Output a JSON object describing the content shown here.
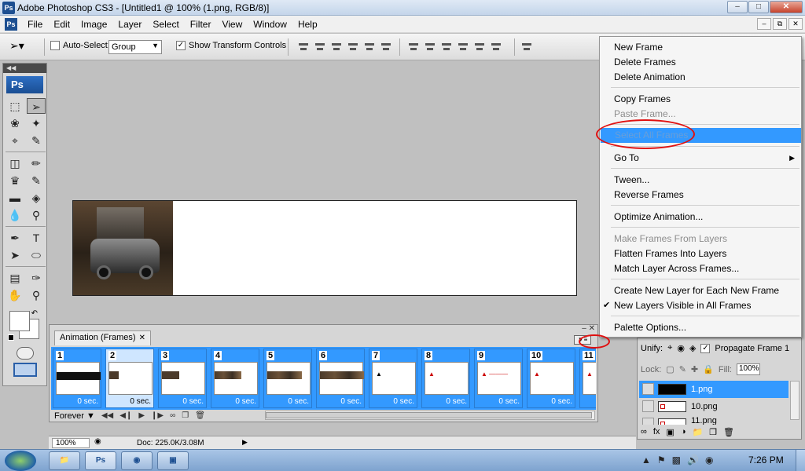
{
  "window": {
    "title": "Adobe Photoshop CS3 - [Untitled1 @ 100% (1.png, RGB/8)]",
    "app_icon": "Ps",
    "controls": [
      "minimize",
      "maximize",
      "close"
    ]
  },
  "menubar": {
    "items": [
      "File",
      "Edit",
      "Image",
      "Layer",
      "Select",
      "Filter",
      "View",
      "Window",
      "Help"
    ]
  },
  "options": {
    "auto_select_label": "Auto-Select:",
    "auto_select_checked": false,
    "auto_select_value": "Group",
    "show_transform_label": "Show Transform Controls",
    "show_transform_checked": true
  },
  "toolbox": {
    "logo": "Ps"
  },
  "context_menu": {
    "items": [
      {
        "label": "New Frame",
        "state": "normal"
      },
      {
        "label": "Delete Frames",
        "state": "normal"
      },
      {
        "label": "Delete Animation",
        "state": "normal"
      },
      {
        "label": "Copy Frames",
        "state": "normal"
      },
      {
        "label": "Paste Frame...",
        "state": "disabled"
      },
      {
        "label": "Select All Frames",
        "state": "highlighted"
      },
      {
        "label": "Go To",
        "state": "submenu"
      },
      {
        "label": "Tween...",
        "state": "normal"
      },
      {
        "label": "Reverse Frames",
        "state": "normal"
      },
      {
        "label": "Optimize Animation...",
        "state": "normal"
      },
      {
        "label": "Make Frames From Layers",
        "state": "disabled"
      },
      {
        "label": "Flatten Frames Into Layers",
        "state": "normal"
      },
      {
        "label": "Match Layer Across Frames...",
        "state": "normal"
      },
      {
        "label": "Create New Layer for Each New Frame",
        "state": "normal"
      },
      {
        "label": "New Layers Visible in All Frames",
        "state": "checked"
      },
      {
        "label": "Palette Options...",
        "state": "normal"
      }
    ],
    "highlight_color": "#3399ff",
    "annotation_color": "#e01010"
  },
  "animation_panel": {
    "tab_label": "Animation (Frames)",
    "frames": [
      {
        "num": "1",
        "delay": "0 sec."
      },
      {
        "num": "2",
        "delay": "0 sec."
      },
      {
        "num": "3",
        "delay": "0 sec."
      },
      {
        "num": "4",
        "delay": "0 sec."
      },
      {
        "num": "5",
        "delay": "0 sec."
      },
      {
        "num": "6",
        "delay": "0 sec."
      },
      {
        "num": "7",
        "delay": "0 sec."
      },
      {
        "num": "8",
        "delay": "0 sec."
      },
      {
        "num": "9",
        "delay": "0 sec."
      },
      {
        "num": "10",
        "delay": "0 sec."
      },
      {
        "num": "11",
        "delay": ""
      }
    ],
    "loop_value": "Forever",
    "frame_strip_color": "#3399ff"
  },
  "layers_panel": {
    "unify_label": "Unify:",
    "propagate_label": "Propagate Frame 1",
    "propagate_checked": true,
    "lock_label": "Lock:",
    "fill_label": "Fill:",
    "fill_value": "100%",
    "layers": [
      {
        "name": "1.png",
        "selected": true
      },
      {
        "name": "10.png",
        "selected": false
      },
      {
        "name": "11.png",
        "selected": false
      }
    ]
  },
  "statusbar": {
    "zoom": "100%",
    "doc_info": "Doc: 225.0K/3.08M"
  },
  "taskbar": {
    "clock": "7:26 PM",
    "ps_button": "Ps"
  }
}
